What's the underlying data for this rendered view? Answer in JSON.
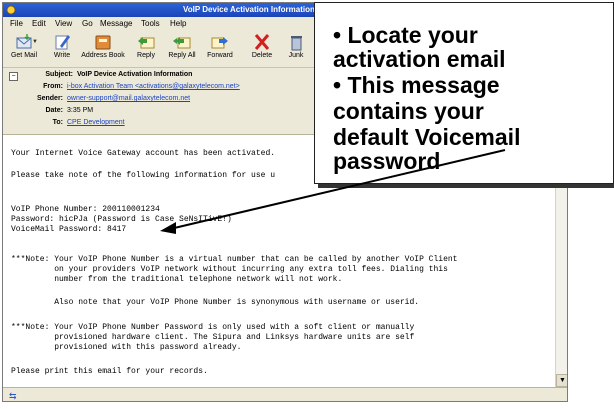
{
  "window": {
    "title": "VoIP Device Activation Information"
  },
  "menu": [
    "File",
    "Edit",
    "View",
    "Go",
    "Message",
    "Tools",
    "Help"
  ],
  "toolbar": [
    {
      "label": "Get Mail",
      "icon": "get-mail-icon"
    },
    {
      "label": "Write",
      "icon": "write-icon"
    },
    {
      "label": "Address Book",
      "icon": "address-book-icon"
    },
    {
      "label": "Reply",
      "icon": "reply-icon"
    },
    {
      "label": "Reply All",
      "icon": "reply-all-icon"
    },
    {
      "label": "Forward",
      "icon": "forward-icon"
    },
    {
      "label": "Delete",
      "icon": "delete-icon"
    },
    {
      "label": "Junk",
      "icon": "junk-icon"
    }
  ],
  "header": {
    "subject_label": "Subject:",
    "subject": "VoIP Device Activation Information",
    "from_label": "From:",
    "from": "i-box Activation Team <activations@galaxytelecom.net>",
    "sender_label": "Sender:",
    "sender": "owner-support@mail.galaxytelecom.net",
    "date_label": "Date:",
    "date": "3:35 PM",
    "to_label": "To:",
    "to": "CPE Development"
  },
  "body_lines": [
    "Your Internet Voice Gateway account has been activated.",
    "Please take note of the following information for use u",
    "VoIP Phone Number: 200110001234",
    "Password: hicPJa (Password is Case SeNsITivE!)",
    "VoiceMail Password: 8417",
    "***Note: Your VoIP Phone Number is a virtual number that can be called by another VoIP Client",
    "         on your providers VoIP network without incurring any extra toll fees. Dialing this",
    "         number from the traditional telephone network will not work.",
    "         Also note that your VoIP Phone Number is synonymous with username or userid.",
    "***Note: Your VoIP Phone Number Password is only used with a soft client or manually",
    "         provisioned hardware client. The Sipura and Linksys hardware units are self",
    "         provisioned with this password already.",
    "Please print this email for your records."
  ],
  "callout_lines": [
    "• Locate your",
    "activation email",
    "• This message",
    "contains your",
    "default Voicemail",
    "password"
  ],
  "colors": {
    "titlebar": "#1f4fc8",
    "chrome": "#ece9d8",
    "link": "#1b45c2"
  }
}
